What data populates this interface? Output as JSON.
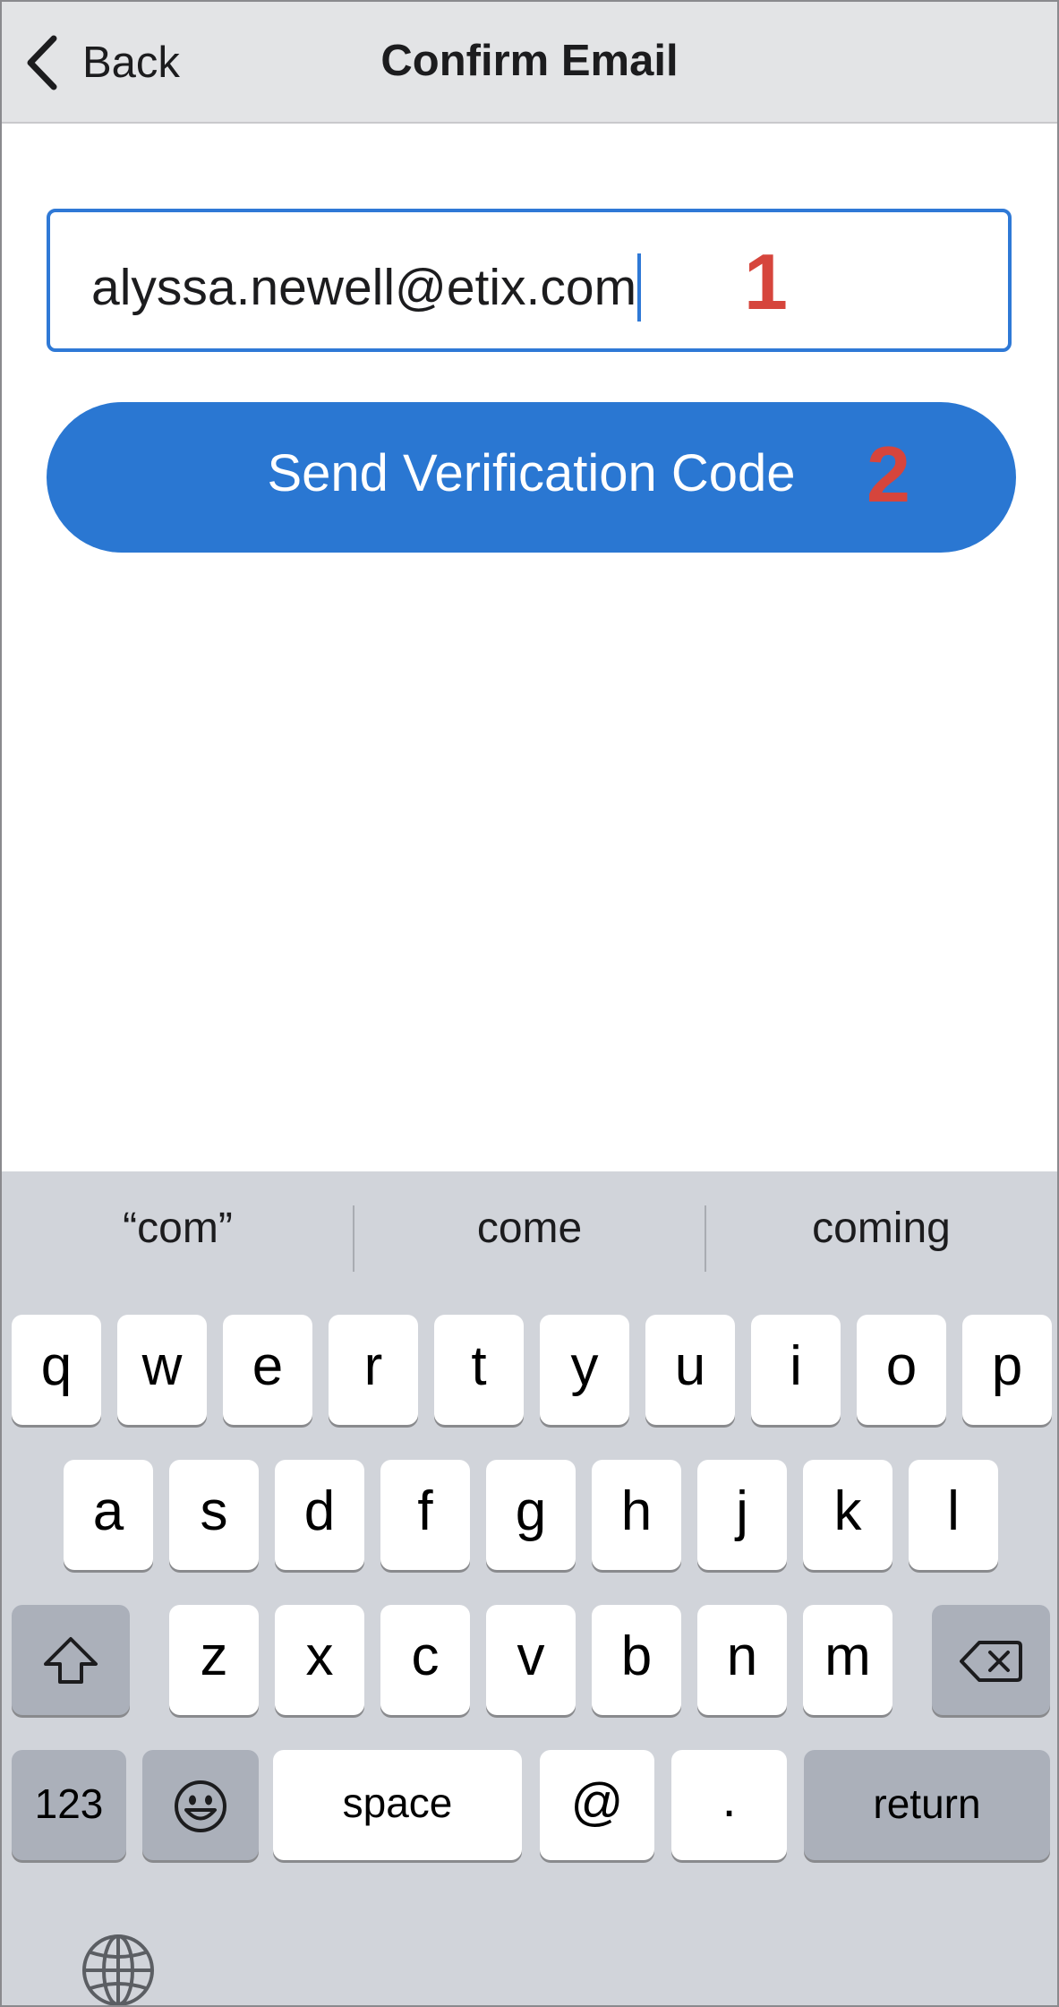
{
  "header": {
    "back_label": "Back",
    "title": "Confirm Email"
  },
  "form": {
    "email_value": "alyssa.newell@etix.com",
    "send_button_label": "Send Verification Code",
    "step_markers": [
      "1",
      "2"
    ]
  },
  "keyboard": {
    "suggestions": [
      "“com”",
      "come",
      "coming"
    ],
    "row1": [
      "q",
      "w",
      "e",
      "r",
      "t",
      "y",
      "u",
      "i",
      "o",
      "p"
    ],
    "row2": [
      "a",
      "s",
      "d",
      "f",
      "g",
      "h",
      "j",
      "k",
      "l"
    ],
    "row3": [
      "z",
      "x",
      "c",
      "v",
      "b",
      "n",
      "m"
    ],
    "numbers_label": "123",
    "space_label": "space",
    "at_label": "@",
    "period_label": ".",
    "return_label": "return",
    "icons": {
      "shift": "shift-icon",
      "backspace": "backspace-icon",
      "emoji": "emoji-icon",
      "globe": "globe-icon"
    }
  },
  "colors": {
    "accent": "#2a77d2",
    "field_border": "#2f79d6",
    "marker": "#d6453c",
    "keyboard_bg": "#d1d4da",
    "nav_bg": "#e3e4e6"
  }
}
